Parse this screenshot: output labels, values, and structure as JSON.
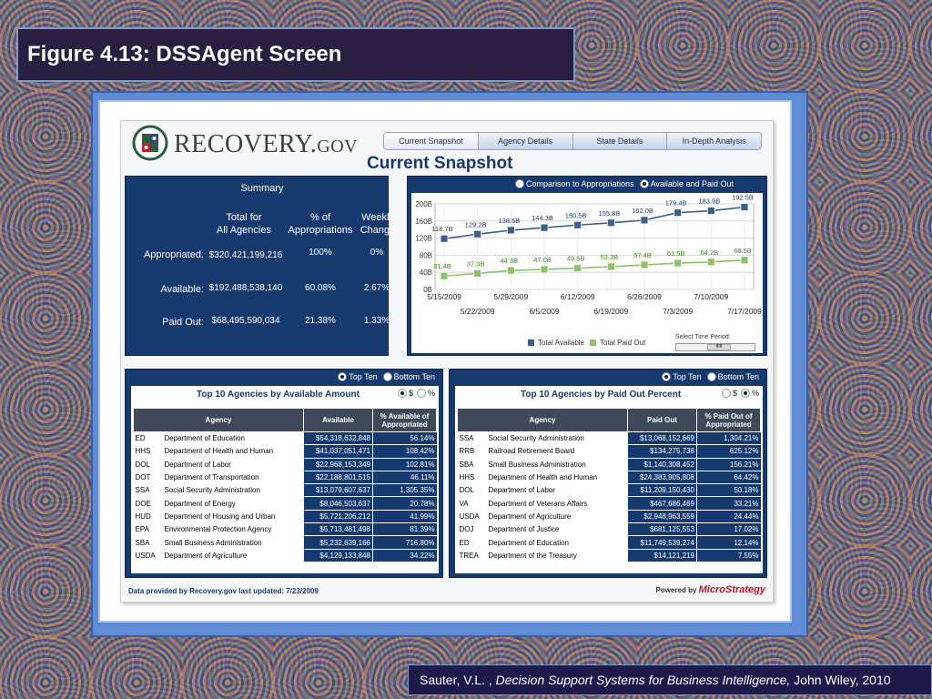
{
  "slide": {
    "title": "Figure 4.13:  DSSAgent Screen",
    "caption_author": "Sauter, V.L. ,",
    "caption_book": "Decision Support Systems for Business Intelligence,",
    "caption_publisher": "John Wiley, 2010"
  },
  "app": {
    "logo_main": "RECOVERY.",
    "logo_gov": "GOV",
    "logo_icon": "eagle-seal-icon",
    "tabs": [
      "Current Snapshot",
      "Agency Details",
      "State Details",
      "In-Depth Analysis"
    ],
    "active_tab": "Current Snapshot",
    "page_heading": "Current Snapshot"
  },
  "summary": {
    "title": "Summary",
    "col1_line1": "Total for",
    "col1_line2": "All Agencies",
    "col2_line1": "% of",
    "col2_line2": "Appropriations",
    "col3_line1": "Weekly",
    "col3_line2": "Change",
    "rows": [
      {
        "label": "Appropriated:",
        "total": "$320,421,199,216",
        "pct": "100%",
        "change": "0%"
      },
      {
        "label": "Available:",
        "total": "$192,488,538,140",
        "pct": "60.08%",
        "change": "2.67%"
      },
      {
        "label": "Paid Out:",
        "total": "$68,495,590,034",
        "pct": "21.38%",
        "change": "1.33%"
      }
    ]
  },
  "chart_panel": {
    "option1": "Comparison to Appropriations",
    "option2": "Available and Paid Out",
    "selected_option": "Available and Paid Out",
    "time_label": "Select Time Period:",
    "slider_thumb": "IIIII"
  },
  "chart_data": {
    "type": "line",
    "x": [
      "5/15/2009",
      "5/22/2009",
      "5/29/2009",
      "6/5/2009",
      "6/12/2009",
      "6/19/2009",
      "6/26/2009",
      "7/3/2009",
      "7/10/2009",
      "7/17/2009"
    ],
    "ylim": [
      0,
      200
    ],
    "yticks": [
      "0B",
      "40B",
      "80B",
      "120B",
      "160B",
      "200B"
    ],
    "ytick_values": [
      0,
      40,
      80,
      120,
      160,
      200
    ],
    "grid": true,
    "legend_position": "bottom",
    "series": [
      {
        "name": "Total Available",
        "color": "#3b5f86",
        "values": [
          118.7,
          129.2,
          138.5,
          144.3,
          150.5,
          155.8,
          162.0,
          179.4,
          183.9,
          192.5
        ],
        "labels": [
          "118.7B",
          "129.2B",
          "138.5B",
          "144.3B",
          "150.5B",
          "155.8B",
          "162.0B",
          "179.4B",
          "183.9B",
          "192.5B"
        ]
      },
      {
        "name": "Total Paid Out",
        "color": "#8fc06a",
        "values": [
          31.4,
          37.3,
          44.3,
          47.0,
          49.5,
          53.3,
          57.4,
          61.5,
          64.2,
          68.5
        ],
        "labels": [
          "31.4B",
          "37.3B",
          "44.3B",
          "47.0B",
          "49.5B",
          "53.3B",
          "57.4B",
          "61.5B",
          "64.2B",
          "68.5B"
        ]
      }
    ]
  },
  "top_filter": {
    "top_ten": "Top Ten",
    "bottom_ten": "Bottom Ten"
  },
  "left_table": {
    "title": "Top 10 Agencies by Available Amount",
    "unit_dollar": "$",
    "unit_percent": "%",
    "selected_unit": "$",
    "headers": [
      "Agency",
      "Available",
      "% Available of Appropriated"
    ],
    "rows": [
      [
        "ED",
        "Department of Education",
        "$54,318,632,848",
        "56.14%"
      ],
      [
        "HHS",
        "Department of Health and Human",
        "$41,037,051,471",
        "108.42%"
      ],
      [
        "DOL",
        "Department of Labor",
        "$22,968,153,349",
        "102.81%"
      ],
      [
        "DOT",
        "Department of Transportation",
        "$22,188,801,515",
        "46.11%"
      ],
      [
        "SSA",
        "Social Security Administration",
        "$13,079,607,637",
        "1,305.35%"
      ],
      [
        "DOE",
        "Department of Energy",
        "$8,046,503,637",
        "20.78%"
      ],
      [
        "HUD",
        "Department of Housing and Urban",
        "$5,721,206,212",
        "41.99%"
      ],
      [
        "EPA",
        "Environmental Protection Agency",
        "$5,713,481,498",
        "81.39%"
      ],
      [
        "SBA",
        "Small Business Administration",
        "$5,232,639,166",
        "716.80%"
      ],
      [
        "USDA",
        "Department of Agriculture",
        "$4,129,133,848",
        "34.22%"
      ]
    ]
  },
  "right_table": {
    "title": "Top 10 Agencies by Paid Out Percent",
    "unit_dollar": "$",
    "unit_percent": "%",
    "selected_unit": "%",
    "headers": [
      "Agency",
      "Paid Out",
      "% Paid Out of Appropriated"
    ],
    "rows": [
      [
        "SSA",
        "Social Security Administration",
        "$13,068,152,669",
        "1,304.21%"
      ],
      [
        "RRB",
        "Railroad Retirement Board",
        "$134,275,738",
        "625.12%"
      ],
      [
        "SBA",
        "Small Business Administration",
        "$1,140,308,452",
        "156.21%"
      ],
      [
        "HHS",
        "Department of Health and Human",
        "$24,383,905,808",
        "64.42%"
      ],
      [
        "DOL",
        "Department of Labor",
        "$11,209,150,430",
        "50.18%"
      ],
      [
        "VA",
        "Department of Veterans Affairs",
        "$467,686,469",
        "33.21%"
      ],
      [
        "USDA",
        "Department of Agriculture",
        "$2,948,963,559",
        "24.44%"
      ],
      [
        "DOJ",
        "Department of Justice",
        "$681,125,553",
        "17.02%"
      ],
      [
        "ED",
        "Department of Education",
        "$11,749,539,274",
        "12.14%"
      ],
      [
        "TREA",
        "Department of the Treasury",
        "$14,121,219",
        "7.55%"
      ]
    ]
  },
  "footer": {
    "left": "Data provided by Recovery.gov last updated: 7/23/2009",
    "powered_by": "Powered by",
    "brand": "MicroStrategy"
  }
}
